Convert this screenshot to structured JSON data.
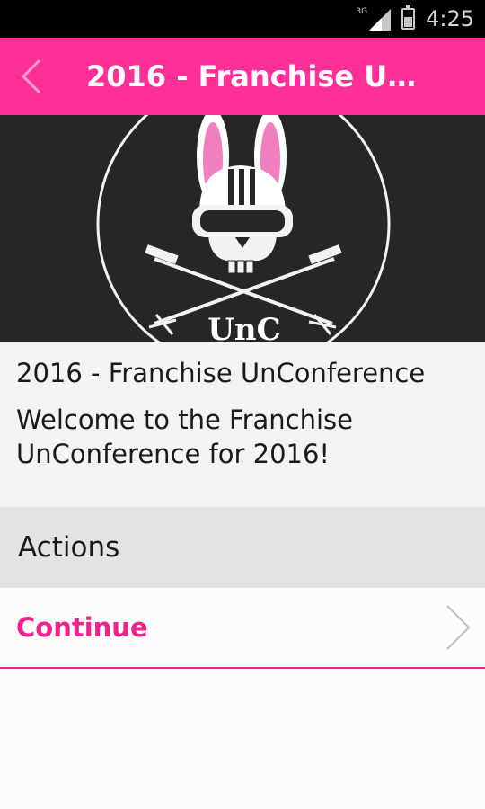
{
  "status_bar": {
    "network_label": "3G",
    "time": "4:25",
    "battery_level": 0.6,
    "icons": [
      "signal-icon",
      "battery-icon"
    ]
  },
  "app_bar": {
    "title": "2016 - Franchise U…",
    "back_icon": "chevron-left-icon",
    "background_color": "#fe2f96"
  },
  "hero": {
    "logo_name": "unc-bunny-skull-logo",
    "logo_text": "UnC"
  },
  "event": {
    "title": "2016 - Franchise UnConference",
    "welcome": "Welcome to the Franchise UnConference for 2016!"
  },
  "actions": {
    "header": "Actions",
    "items": [
      {
        "label": "Continue",
        "icon": "chevron-right-icon"
      }
    ]
  },
  "colors": {
    "accent": "#f0228d",
    "status_bar": "#000000",
    "hero_background": "#262626"
  }
}
